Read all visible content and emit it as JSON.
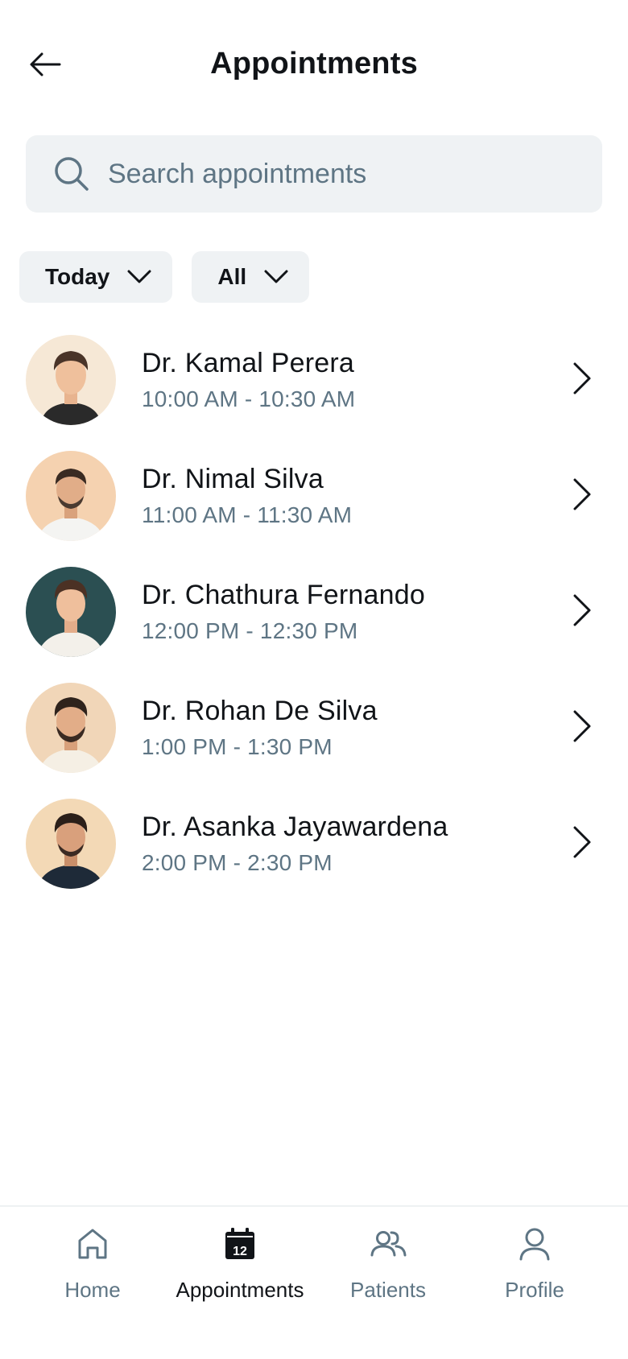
{
  "header": {
    "title": "Appointments"
  },
  "search": {
    "placeholder": "Search appointments"
  },
  "filters": [
    {
      "label": "Today"
    },
    {
      "label": "All"
    }
  ],
  "appointments": [
    {
      "name": "Dr. Kamal Perera",
      "time": "10:00 AM - 10:30 AM"
    },
    {
      "name": "Dr. Nimal Silva",
      "time": "11:00 AM - 11:30 AM"
    },
    {
      "name": "Dr. Chathura Fernando",
      "time": "12:00 PM - 12:30 PM"
    },
    {
      "name": "Dr. Rohan De Silva",
      "time": "1:00 PM - 1:30 PM"
    },
    {
      "name": "Dr. Asanka Jayawardena",
      "time": "2:00 PM - 2:30 PM"
    }
  ],
  "tabbar": {
    "items": [
      {
        "label": "Home",
        "icon": "home-icon"
      },
      {
        "label": "Appointments",
        "icon": "calendar-icon",
        "active": true,
        "calendar_day": "12"
      },
      {
        "label": "Patients",
        "icon": "users-icon"
      },
      {
        "label": "Profile",
        "icon": "user-icon"
      }
    ]
  },
  "colors": {
    "text": "#111418",
    "muted": "#5e7584",
    "surface": "#eff2f4"
  }
}
